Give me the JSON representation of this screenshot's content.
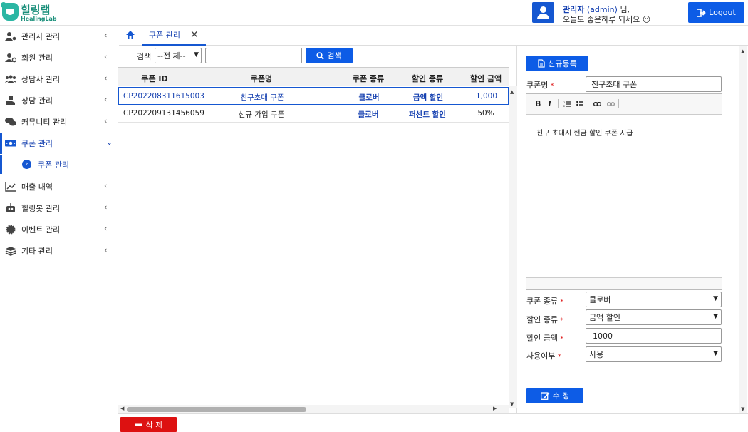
{
  "header": {
    "logo_text": "힐링랩",
    "logo_sub": "HealingLab",
    "user_name": "관리자",
    "user_id": "(admin)",
    "user_suffix": "님,",
    "greeting": "오늘도 좋은하루 되세요 ☺",
    "logout_label": "Logout"
  },
  "sidebar": {
    "items": [
      {
        "label": "관리자 관리",
        "icon": "user-gear-icon"
      },
      {
        "label": "회원 관리",
        "icon": "user-cog-icon"
      },
      {
        "label": "상담사 관리",
        "icon": "users-icon"
      },
      {
        "label": "상담 관리",
        "icon": "hand-holding-icon"
      },
      {
        "label": "커뮤니티 관리",
        "icon": "comments-icon"
      },
      {
        "label": "쿠폰 관리",
        "icon": "ticket-icon"
      },
      {
        "label": "매출 내역",
        "icon": "chart-line-icon"
      },
      {
        "label": "힐링봇 관리",
        "icon": "robot-icon"
      },
      {
        "label": "이벤트 관리",
        "icon": "certificate-icon"
      },
      {
        "label": "기타 관리",
        "icon": "layers-icon"
      }
    ],
    "sub_item": "쿠폰 관리",
    "accent": "#1557d1"
  },
  "tabs": {
    "home_icon": "home-icon",
    "active_tab": "쿠폰 관리",
    "close_glyph": "✕"
  },
  "search": {
    "label": "검색",
    "select_value": "--전 체--",
    "input_value": "",
    "button_label": "검색"
  },
  "grid": {
    "columns": [
      "쿠폰 ID",
      "쿠폰명",
      "쿠폰 종류",
      "할인 종류",
      "할인 금액"
    ],
    "rows": [
      {
        "id": "CP202208311615003",
        "name": "친구초대 쿠폰",
        "type": "클로버",
        "discount_type": "금액 할인",
        "amount": "1,000"
      },
      {
        "id": "CP202209131456059",
        "name": "신규 가입 쿠폰",
        "type": "클로버",
        "discount_type": "퍼센트 할인",
        "amount": "50%"
      }
    ]
  },
  "actions": {
    "delete_label": "삭 제",
    "new_label": "신규등록",
    "update_label": "수 정"
  },
  "form": {
    "name_label": "쿠폰명",
    "name_value": "친구초대 쿠폰",
    "editor_body": "친구 초대시 현금 할인 쿠폰 지급",
    "toolbar": [
      "B",
      "I"
    ],
    "coupon_type_label": "쿠폰 종류",
    "coupon_type_value": "클로버",
    "discount_type_label": "할인 종류",
    "discount_type_value": "금액 할인",
    "amount_label": "할인 금액",
    "amount_value": "1000",
    "use_label": "사용여부",
    "use_value": "사용",
    "required_mark": "*"
  }
}
